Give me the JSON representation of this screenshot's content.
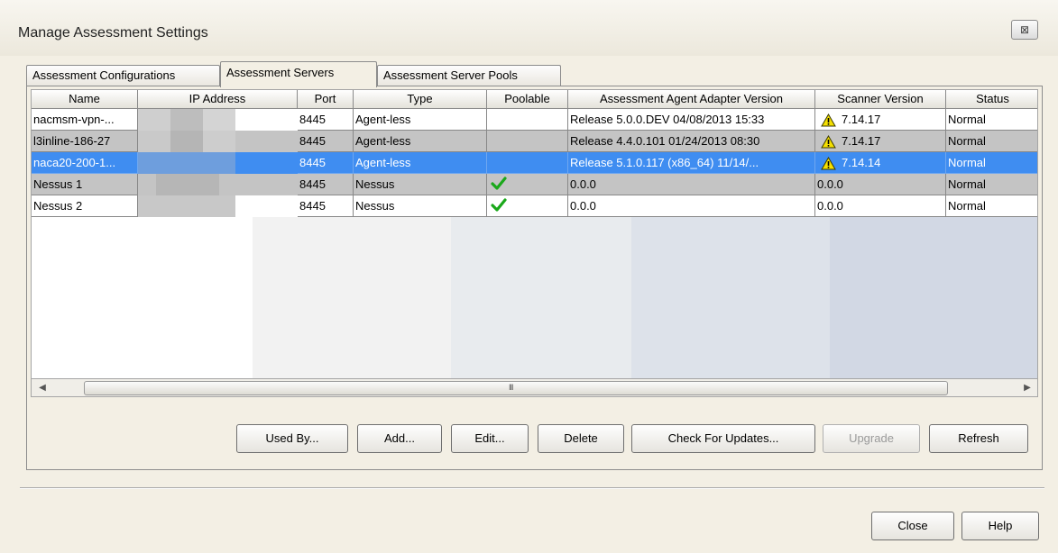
{
  "window": {
    "title": "Manage Assessment Settings",
    "close_glyph": "⊠"
  },
  "tabs": [
    {
      "label": "Assessment Configurations"
    },
    {
      "label": "Assessment Servers"
    },
    {
      "label": "Assessment Server Pools"
    }
  ],
  "table": {
    "columns": [
      "Name",
      "IP Address",
      "Port",
      "Type",
      "Poolable",
      "Assessment Agent Adapter Version",
      "Scanner Version",
      "Status"
    ],
    "rows": [
      {
        "name": "nacmsm-vpn-...",
        "port": "8445",
        "type": "Agent-less",
        "poolable": false,
        "adapter": "Release 5.0.0.DEV 04/08/2013 15:33",
        "scanner_warning": true,
        "scanner": "7.14.17",
        "status": "Normal"
      },
      {
        "name": "l3inline-186-27",
        "port": "8445",
        "type": "Agent-less",
        "poolable": false,
        "adapter": "Release 4.4.0.101 01/24/2013 08:30",
        "scanner_warning": true,
        "scanner": "7.14.17",
        "status": "Normal"
      },
      {
        "name": "naca20-200-1...",
        "port": "8445",
        "type": "Agent-less",
        "poolable": false,
        "adapter": "Release 5.1.0.117 (x86_64) 11/14/...",
        "scanner_warning": true,
        "scanner": "7.14.14",
        "status": "Normal"
      },
      {
        "name": "Nessus 1",
        "port": "8445",
        "type": "Nessus",
        "poolable": true,
        "adapter": "0.0.0",
        "scanner_warning": false,
        "scanner": "0.0.0",
        "status": "Normal"
      },
      {
        "name": "Nessus 2",
        "port": "8445",
        "type": "Nessus",
        "poolable": true,
        "adapter": "0.0.0",
        "scanner_warning": false,
        "scanner": "0.0.0",
        "status": "Normal"
      }
    ],
    "selected_row": 2
  },
  "scrollbar": {
    "left_arrow": "◀",
    "right_arrow": "▶",
    "grip": "III"
  },
  "buttons": {
    "used_by": "Used By...",
    "add": "Add...",
    "edit": "Edit...",
    "delete": "Delete",
    "check_updates": "Check For Updates...",
    "upgrade": "Upgrade",
    "refresh": "Refresh",
    "close": "Close",
    "help": "Help"
  },
  "icons": {
    "warning": "warning-triangle-icon",
    "poolable": "green-check-icon"
  },
  "colors": {
    "selection": "#3f8df1",
    "gray_row": "#c4c4c4",
    "check_green": "#1aa81a",
    "warning_yellow": "#f5e000"
  }
}
